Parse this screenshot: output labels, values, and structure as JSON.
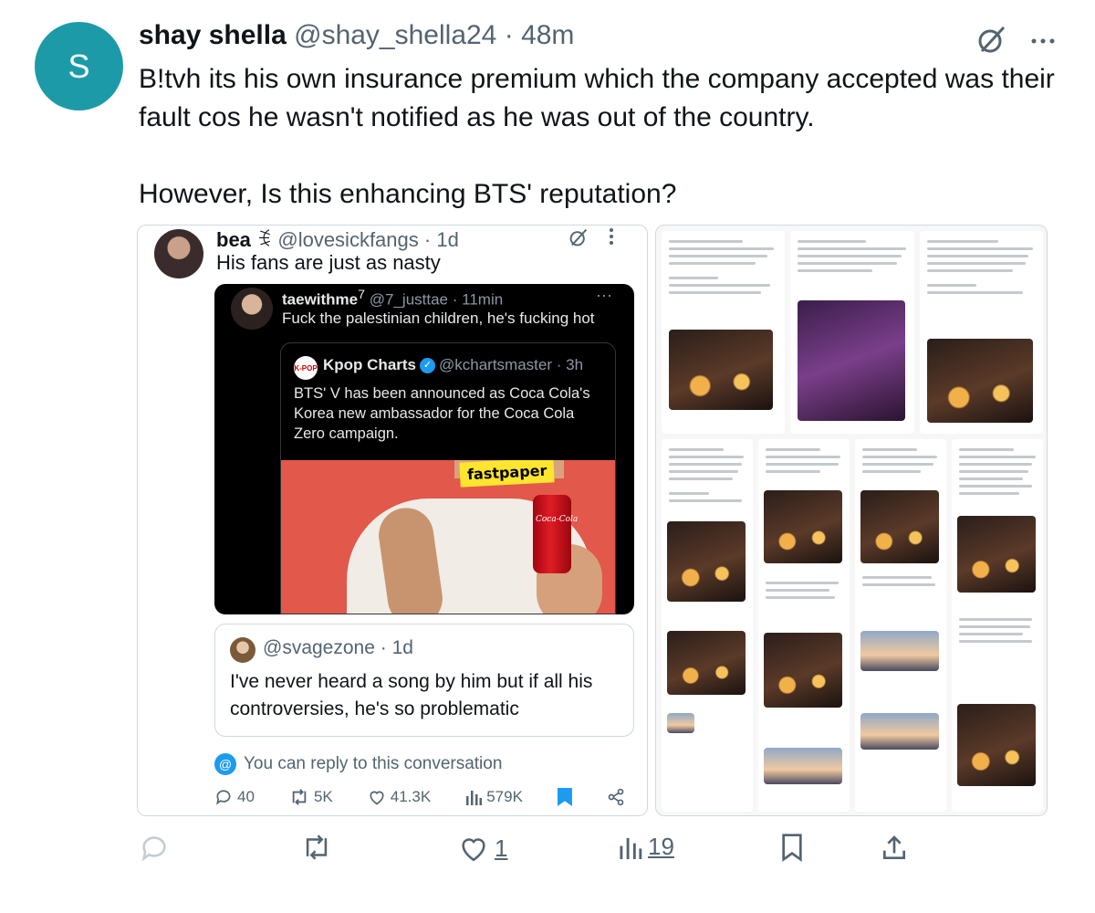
{
  "tweet": {
    "avatar_letter": "S",
    "display_name": "shay shella",
    "handle": "@shay_shella24",
    "separator": "·",
    "time": "48m",
    "text": "B!tvh its his own insurance premium which the company accepted was their fault cos he wasn't notified as he was out of the country.\n\nHowever, Is this enhancing BTS' reputation?",
    "more_icon": "more-icon",
    "grok_icon": "grok-icon"
  },
  "embedded": {
    "display_name": "bea",
    "display_name_suffix": "ꉂ",
    "handle": "@lovesickfangs",
    "time": "1d",
    "text": "His fans are just as nasty",
    "dark_card": {
      "display_name": "taewithme",
      "superscript": "7",
      "handle": "@7_justtae",
      "time": "11min",
      "text": "Fuck the palestinian children, he's fucking hot",
      "more": "···",
      "inner": {
        "logo_text": "K-POP",
        "display_name": "Kpop Charts",
        "verified_mark": "✓",
        "handle": "@kchartsmaster",
        "time": "3h",
        "text": "BTS' V has been announced as Coca Cola's Korea new ambassador for the Coca Cola Zero campaign.",
        "image_tag": "fastpaper",
        "can_text": "Coca-Cola"
      }
    },
    "quote": {
      "handle": "@svagezone",
      "time": "1d",
      "text": "I've never heard a song by him but if all his controversies, he's so problematic"
    },
    "reply_note": "You can reply to this conversation",
    "stats": {
      "replies": "40",
      "reposts": "5K",
      "likes": "41.3K",
      "views": "579K"
    }
  },
  "actions": {
    "likes": "1",
    "views": "19"
  },
  "colors": {
    "accent": "#1d9bf0",
    "avatar_bg": "#1d9aa8",
    "muted": "#536471"
  }
}
